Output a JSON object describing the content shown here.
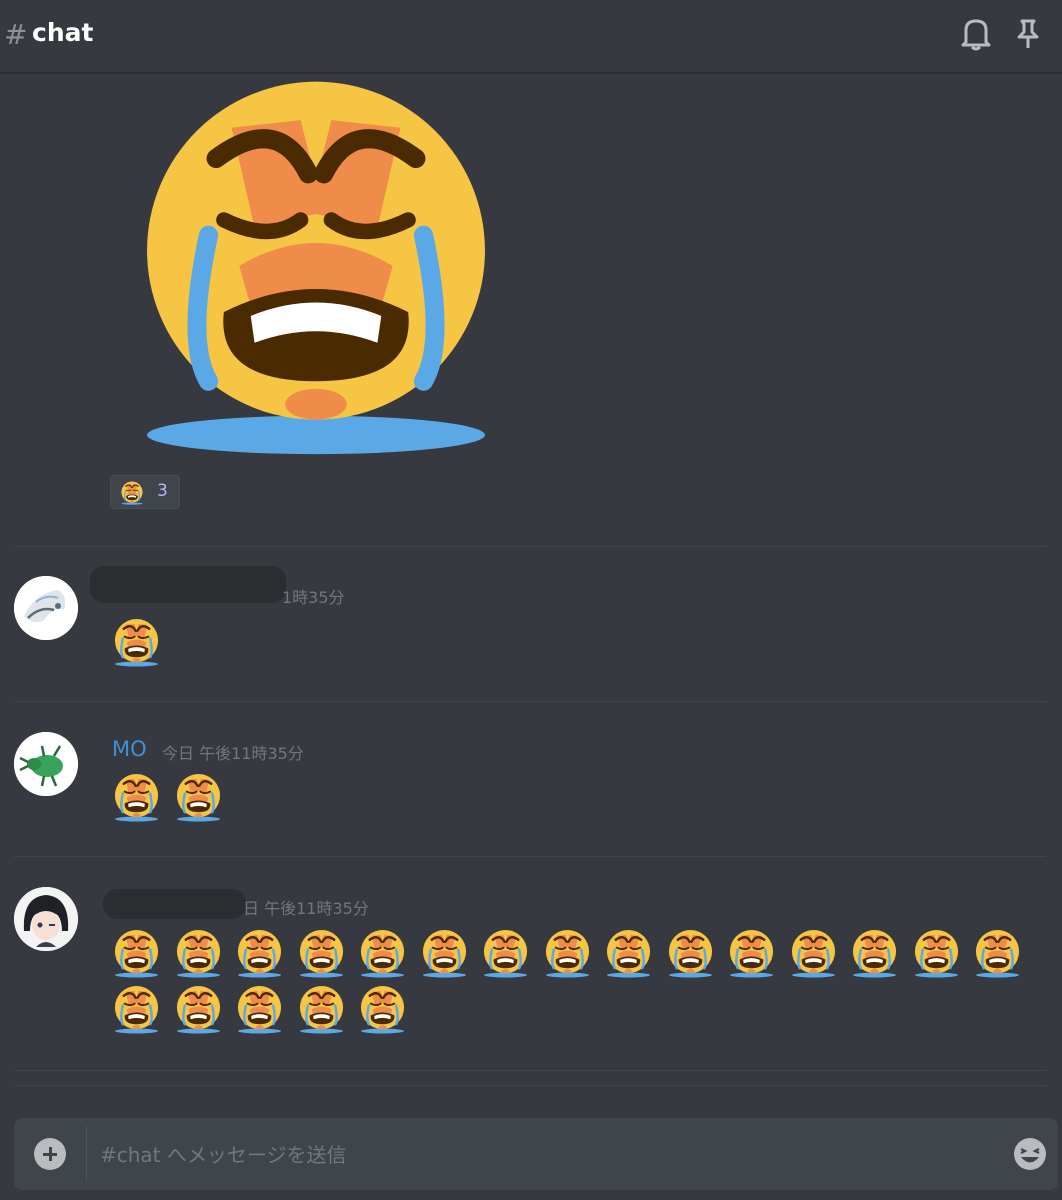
{
  "header": {
    "hash": "#",
    "title": "chat"
  },
  "reaction": {
    "count": "3"
  },
  "messages": [
    {
      "timestamp_visible": "1時35分",
      "emoji_count": 1
    },
    {
      "username": "MO",
      "timestamp": "今日 午後11時35分",
      "emoji_count": 2
    },
    {
      "timestamp_visible": "日 午後11時35分",
      "emoji_count": 20
    }
  ],
  "composer": {
    "placeholder": "#chat へメッセージを送信"
  },
  "icons": [
    "bell-icon",
    "pin-icon",
    "add-attachment-icon",
    "emoji-picker-icon",
    "crying-face-emoji"
  ],
  "colors": {
    "background": "#36393f",
    "username": "#3e91d6",
    "reaction_count": "#b3b8f5"
  }
}
